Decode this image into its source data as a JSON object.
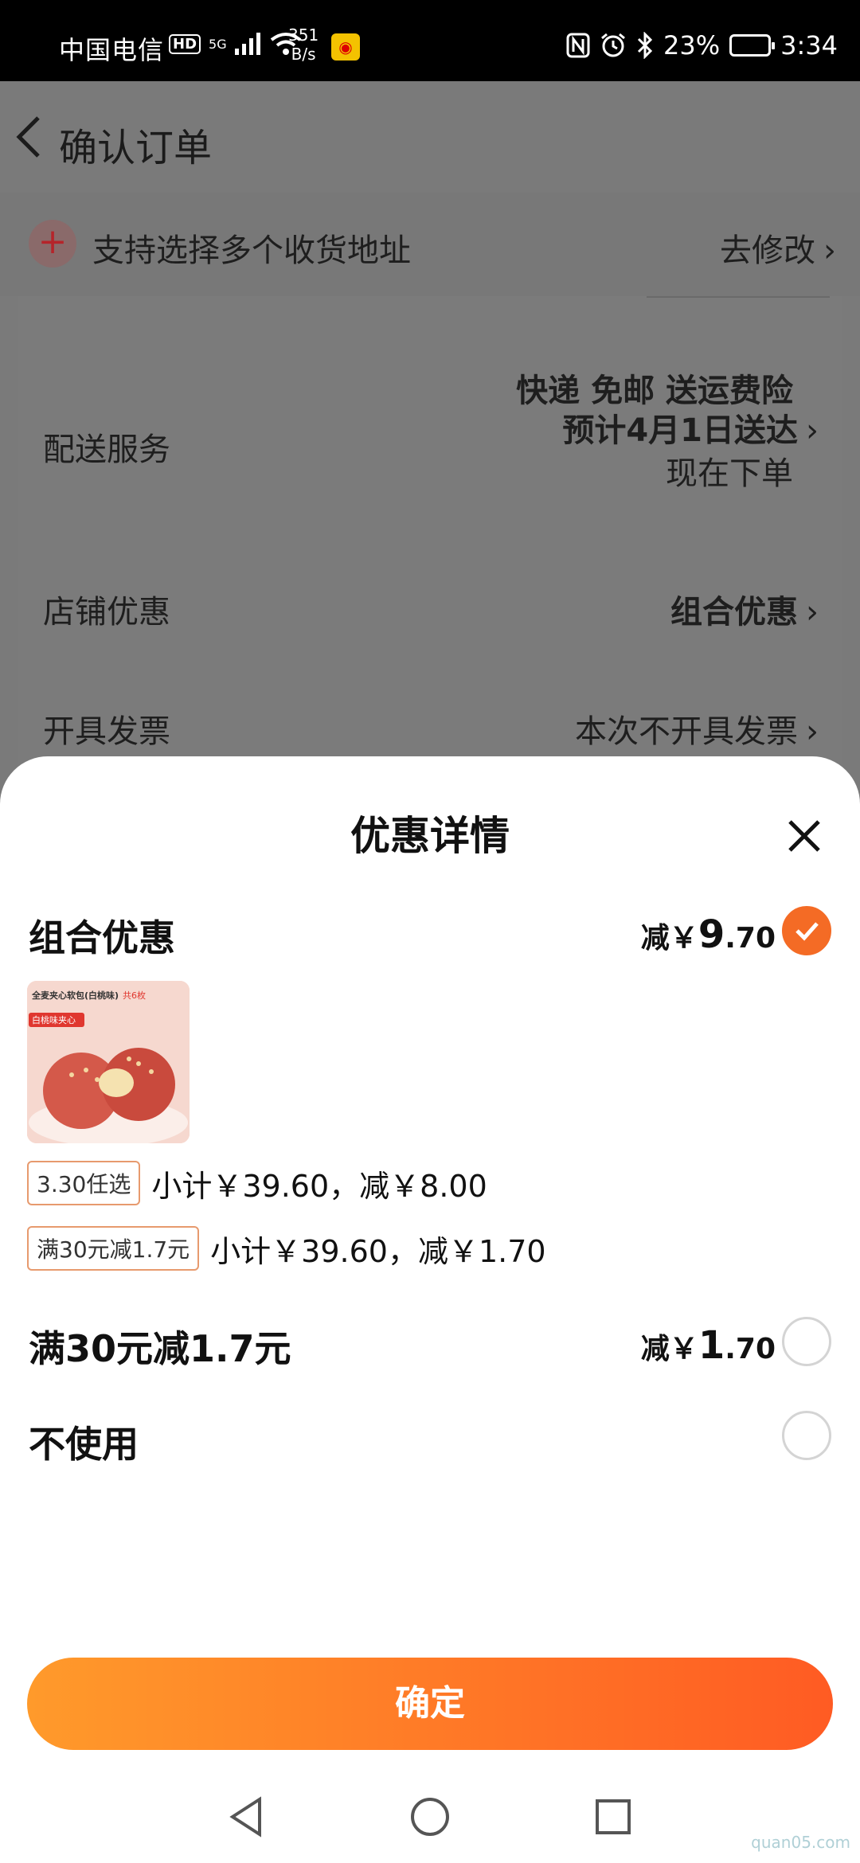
{
  "status_bar": {
    "carrier": "中国电信",
    "hd": "HD",
    "network": "5G",
    "net_speed_value": "351",
    "net_speed_unit": "B/s",
    "battery": "23%",
    "time": "3:34"
  },
  "header": {
    "title": "确认订单"
  },
  "address_bar": {
    "label": "支持选择多个收货地址",
    "action": "去修改"
  },
  "delivery": {
    "label": "配送服务",
    "line1": "快递 免邮 送运费险",
    "line2": "预计4月1日送达",
    "line3": "现在下单"
  },
  "shop_discount": {
    "label": "店铺优惠",
    "value": "组合优惠"
  },
  "invoice": {
    "label": "开具发票",
    "value": "本次不开具发票"
  },
  "sheet": {
    "title": "优惠详情",
    "options": [
      {
        "title": "组合优惠",
        "amount_prefix": "减￥",
        "amount_int": "9",
        "amount_dec": ".70",
        "checked": true
      },
      {
        "title": "满30元减1.7元",
        "amount_prefix": "减￥",
        "amount_int": "1",
        "amount_dec": ".70",
        "checked": false
      },
      {
        "title": "不使用",
        "checked": false
      }
    ],
    "product": {
      "image_heading": "全麦夹心软包(白桃味)",
      "image_badge": "白桃味夹心",
      "image_count": "共6枚"
    },
    "details": [
      {
        "tag": "3.30任选",
        "text": "小计￥39.60，减￥8.00"
      },
      {
        "tag": "满30元减1.7元",
        "text": "小计￥39.60，减￥1.70"
      }
    ],
    "confirm": "确定"
  },
  "watermark": "quan05.com",
  "colors": {
    "accent": "#f46b25",
    "button_start": "#ff9a2b",
    "button_end": "#ff5b23"
  }
}
